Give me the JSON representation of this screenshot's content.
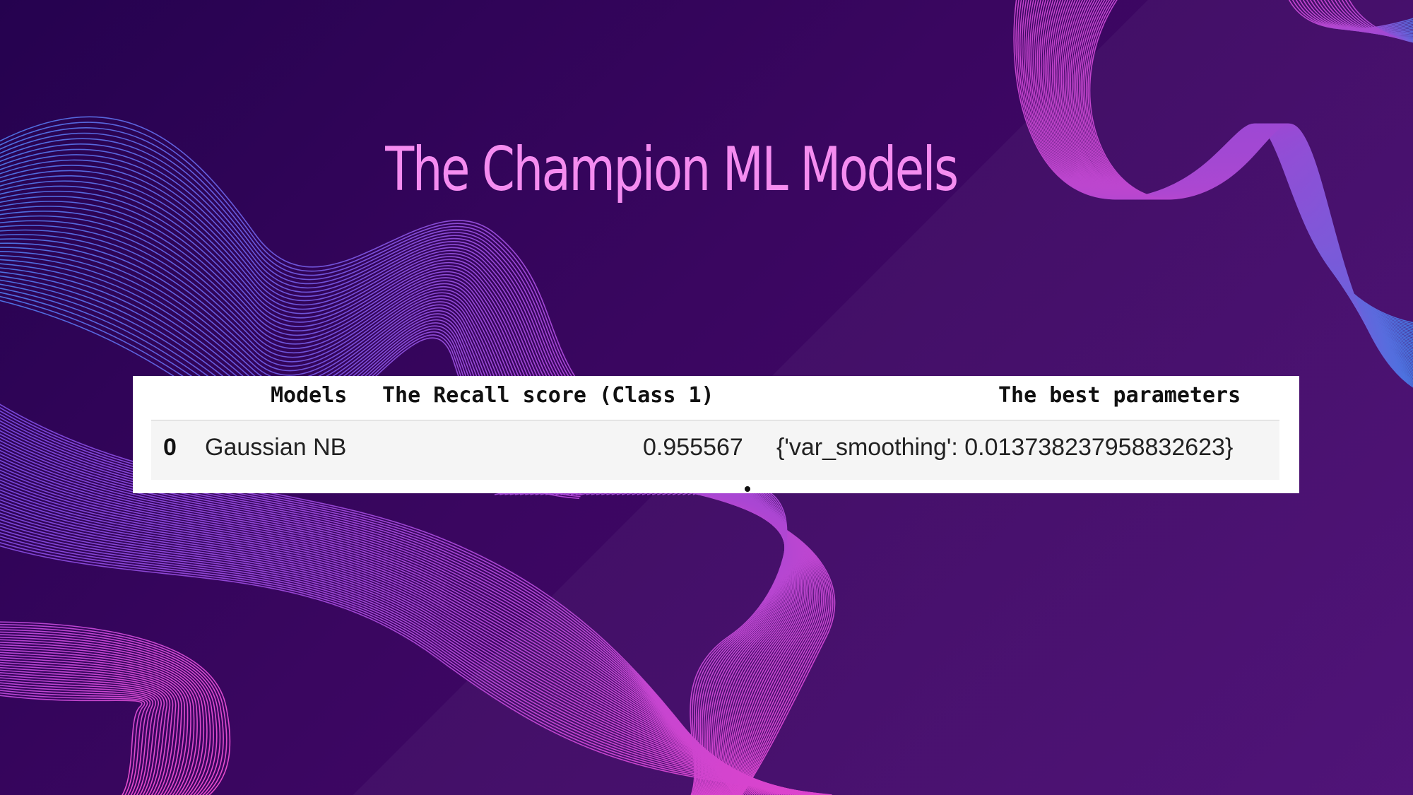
{
  "slide": {
    "title": "The Champion ML Models",
    "colors": {
      "background_start": "#25024f",
      "background_end": "#4a0b73",
      "title": "#f58cf0",
      "wave_blue": "#3a78e8",
      "wave_magenta": "#e43fd8"
    }
  },
  "table": {
    "headers": {
      "models": "Models",
      "recall": "The Recall score (Class 1)",
      "params": "The best parameters"
    },
    "rows": [
      {
        "index": "0",
        "model": "Gaussian NB",
        "recall": "0.955567",
        "params": "{'var_smoothing': 0.013738237958832623}"
      }
    ]
  }
}
